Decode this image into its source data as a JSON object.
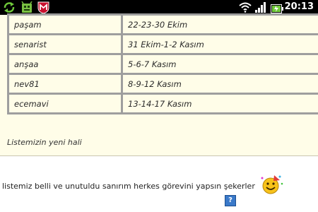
{
  "status_bar": {
    "time": "20:13",
    "icons": [
      "refresh-icon",
      "android-icon",
      "mcafee-shield-icon",
      "wifi-icon",
      "signal-icon",
      "battery-icon"
    ]
  },
  "quote": {
    "rows": [
      {
        "name": "paşam",
        "dates": "22-23-30 Ekim"
      },
      {
        "name": "senarist",
        "dates": "31 Ekim-1-2 Kasım"
      },
      {
        "name": "anşaa",
        "dates": "5-6-7 Kasım"
      },
      {
        "name": "nev81",
        "dates": "8-9-12 Kasım"
      },
      {
        "name": "ecemavi",
        "dates": "13-14-17 Kasım"
      }
    ],
    "caption": "Listemizin yeni hali"
  },
  "post": {
    "text": "listemiz belli ve unutuldu sanırım herkes görevini yapsın şekerler"
  },
  "colors": {
    "status_bar": "#000000",
    "quote_background": "#fffde8",
    "table_border": "#9e9e9e"
  }
}
